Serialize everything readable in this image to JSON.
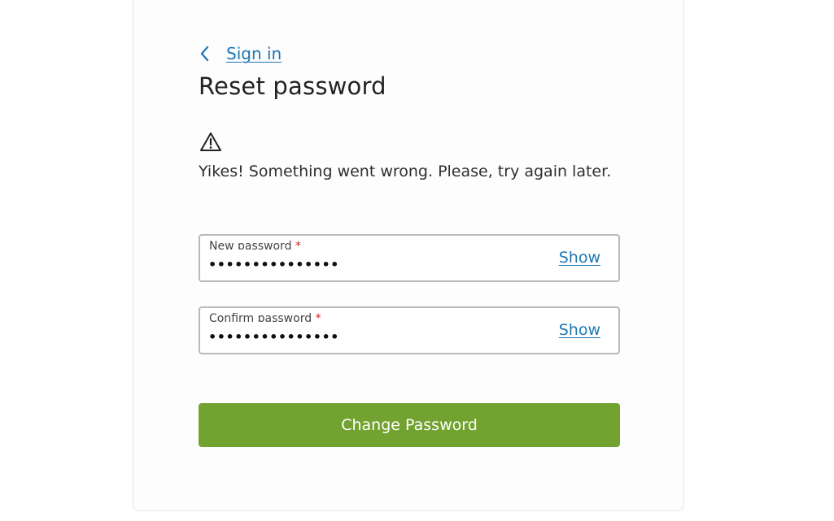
{
  "header": {
    "back_label": "Sign in",
    "title": "Reset password"
  },
  "alert": {
    "icon": "warning-triangle-icon",
    "message": "Yikes! Something went wrong. Please, try again later."
  },
  "form": {
    "new_password": {
      "label": "New password",
      "required_mark": "*",
      "value": "•••••••••••••••",
      "toggle_label": "Show"
    },
    "confirm_password": {
      "label": "Confirm password",
      "required_mark": "*",
      "value": "•••••••••••••••",
      "toggle_label": "Show"
    },
    "submit_label": "Change Password"
  },
  "colors": {
    "link": "#1f78b4",
    "primary_button": "#72a22f",
    "required": "#c62828"
  }
}
